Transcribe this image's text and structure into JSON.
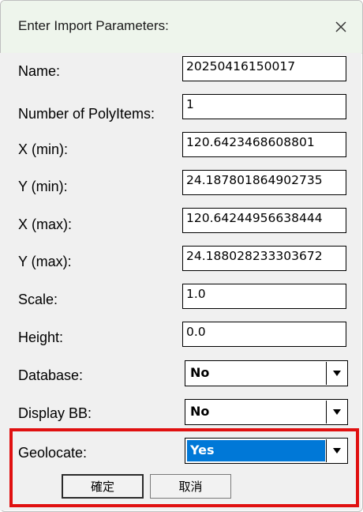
{
  "dialog": {
    "title": "Enter Import Parameters:",
    "close_icon": "close-icon"
  },
  "fields": [
    {
      "label": "Name:",
      "value": "20250416150017"
    },
    {
      "label": "Number of PolyItems:",
      "value": "1"
    },
    {
      "label": "X (min):",
      "value": "120.6423468608801"
    },
    {
      "label": "Y (min):",
      "value": "24.187801864902735"
    },
    {
      "label": "X (max):",
      "value": "120.64244956638444"
    },
    {
      "label": "Y (max):",
      "value": "24.188028233303672"
    },
    {
      "label": "Scale:",
      "value": "1.0"
    },
    {
      "label": "Height:",
      "value": "0.0"
    }
  ],
  "dropdowns": [
    {
      "label": "Database:",
      "value": "No"
    },
    {
      "label": "Display BB:",
      "value": "No"
    },
    {
      "label": "Geolocate:",
      "value": "Yes",
      "selected": true
    }
  ],
  "buttons": {
    "ok_label": "確定",
    "cancel_label": "取消"
  },
  "colors": {
    "titlebar": "#eef5ec",
    "selection": "#0078d7",
    "highlight_border": "#e01010",
    "panel": "#f0f0f0"
  }
}
